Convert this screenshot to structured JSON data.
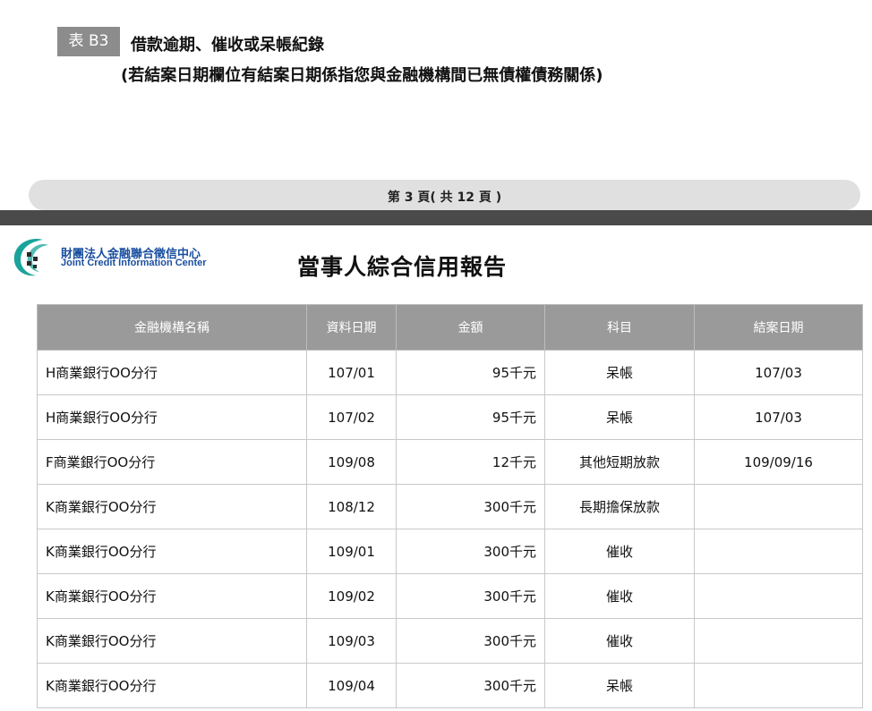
{
  "section": {
    "tag": "表 B3",
    "title": "借款逾期、催收或呆帳紀錄",
    "subtitle": "(若結案日期欄位有結案日期係指您與金融機構間已無債權債務關係)"
  },
  "pagination": {
    "text": "第 3 頁( 共 12 頁 )"
  },
  "header": {
    "org_name_zh": "財團法人金融聯合徵信中心",
    "org_name_en": "Joint Credit Information Center",
    "report_title": "當事人綜合信用報告"
  },
  "colors": {
    "table_header_bg": "#9a9a9a",
    "divider": "#4a4a4a",
    "org_blue": "#1a4fa0",
    "logo_teal": "#1aa39b"
  },
  "table": {
    "columns": [
      "金融機構名稱",
      "資料日期",
      "金額",
      "科目",
      "結案日期"
    ],
    "rows": [
      {
        "name": "H商業銀行OO分行",
        "date": "107/01",
        "amount": "95千元",
        "item": "呆帳",
        "close": "107/03"
      },
      {
        "name": "H商業銀行OO分行",
        "date": "107/02",
        "amount": "95千元",
        "item": "呆帳",
        "close": "107/03"
      },
      {
        "name": "F商業銀行OO分行",
        "date": "109/08",
        "amount": "12千元",
        "item": "其他短期放款",
        "close": "109/09/16"
      },
      {
        "name": "K商業銀行OO分行",
        "date": "108/12",
        "amount": "300千元",
        "item": "長期擔保放款",
        "close": ""
      },
      {
        "name": "K商業銀行OO分行",
        "date": "109/01",
        "amount": "300千元",
        "item": "催收",
        "close": ""
      },
      {
        "name": "K商業銀行OO分行",
        "date": "109/02",
        "amount": "300千元",
        "item": "催收",
        "close": ""
      },
      {
        "name": "K商業銀行OO分行",
        "date": "109/03",
        "amount": "300千元",
        "item": "催收",
        "close": ""
      },
      {
        "name": "K商業銀行OO分行",
        "date": "109/04",
        "amount": "300千元",
        "item": "呆帳",
        "close": ""
      }
    ]
  }
}
